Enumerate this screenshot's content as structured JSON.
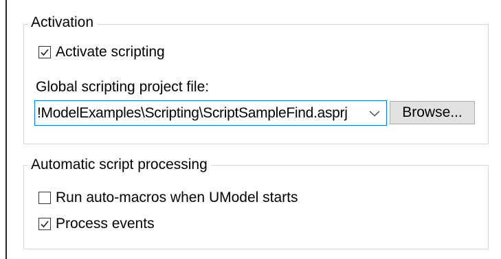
{
  "activation_group": {
    "legend": "Activation",
    "activate_scripting": {
      "label": "Activate scripting",
      "checked": true
    },
    "project_file_label": "Global scripting project file:",
    "project_file_value": "!ModelExamples\\Scripting\\ScriptSampleFind.asprj",
    "browse_label": "Browse..."
  },
  "automatic_group": {
    "legend": "Automatic script processing",
    "run_auto_macros": {
      "label": "Run auto-macros when UModel starts",
      "checked": false
    },
    "process_events": {
      "label": "Process events",
      "checked": true
    }
  },
  "colors": {
    "focus_border": "#0078d7",
    "button_face": "#e1e1e1",
    "group_border": "#d8d8d8"
  },
  "icons": {
    "checkmark": "checkmark-icon",
    "dropdown": "chevron-down-icon"
  }
}
